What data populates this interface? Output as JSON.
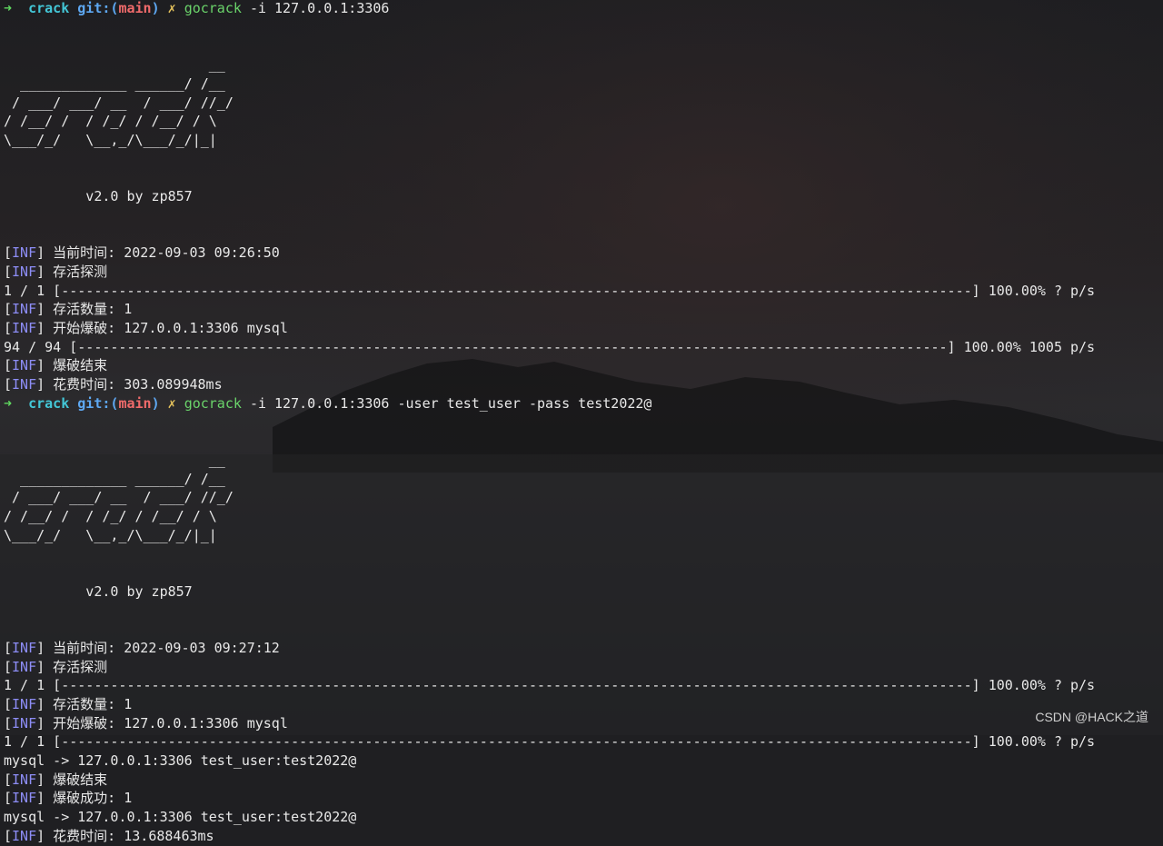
{
  "prompt": {
    "arrow": "➜",
    "dir": "crack",
    "git_open": "git:(",
    "branch": "main",
    "git_close": ")",
    "dirty": "✗",
    "command": "gocrack"
  },
  "run1": {
    "args": "-i 127.0.0.1:3306",
    "banner": [
      "                         __",
      "  _____________ ______/ /__",
      " / ___/ ___/ __  / ___/ //_/",
      "/ /__/ /  / /_/ / /__/ / \\",
      "\\___/_/   \\__,_/\\___/_/|_|"
    ],
    "version": "          v2.0 by zp857",
    "lines": [
      {
        "kind": "inf",
        "text": " 当前时间: 2022-09-03 09:26:50"
      },
      {
        "kind": "inf",
        "text": " 存活探测"
      },
      {
        "kind": "bar",
        "text": "1 / 1 [---------------------------------------------------------------------------------------------------------------] 100.00% ? p/s"
      },
      {
        "kind": "inf",
        "text": " 存活数量: 1"
      },
      {
        "kind": "inf",
        "text": " 开始爆破: 127.0.0.1:3306 mysql"
      },
      {
        "kind": "bar",
        "text": "94 / 94 [----------------------------------------------------------------------------------------------------------] 100.00% 1005 p/s"
      },
      {
        "kind": "inf",
        "text": " 爆破结束"
      },
      {
        "kind": "inf",
        "text": " 花费时间: 303.089948ms"
      }
    ]
  },
  "run2": {
    "args": "-i 127.0.0.1:3306 -user test_user -pass test2022@",
    "banner": [
      "                         __",
      "  _____________ ______/ /__",
      " / ___/ ___/ __  / ___/ //_/",
      "/ /__/ /  / /_/ / /__/ / \\",
      "\\___/_/   \\__,_/\\___/_/|_|"
    ],
    "version": "          v2.0 by zp857",
    "lines": [
      {
        "kind": "inf",
        "text": " 当前时间: 2022-09-03 09:27:12"
      },
      {
        "kind": "inf",
        "text": " 存活探测"
      },
      {
        "kind": "bar",
        "text": "1 / 1 [---------------------------------------------------------------------------------------------------------------] 100.00% ? p/s"
      },
      {
        "kind": "inf",
        "text": " 存活数量: 1"
      },
      {
        "kind": "inf",
        "text": " 开始爆破: 127.0.0.1:3306 mysql"
      },
      {
        "kind": "bar",
        "text": "1 / 1 [---------------------------------------------------------------------------------------------------------------] 100.00% ? p/s"
      },
      {
        "kind": "plain",
        "text": "mysql -> 127.0.0.1:3306 test_user:test2022@"
      },
      {
        "kind": "inf",
        "text": " 爆破结束"
      },
      {
        "kind": "inf",
        "text": " 爆破成功: 1"
      },
      {
        "kind": "plain",
        "text": "mysql -> 127.0.0.1:3306 test_user:test2022@"
      },
      {
        "kind": "inf",
        "text": " 花费时间: 13.688463ms"
      }
    ]
  },
  "inf_tag": "INF",
  "watermark": "CSDN @HACK之道",
  "colors": {
    "background": "#1f1f22",
    "text": "#e8e8e8",
    "inf_tag": "#8d8df6",
    "prompt_arrow": "#5fd75f",
    "prompt_dir": "#43c6d6",
    "git": "#5ea8f2",
    "branch": "#f06b6b",
    "command": "#6ad36a"
  }
}
